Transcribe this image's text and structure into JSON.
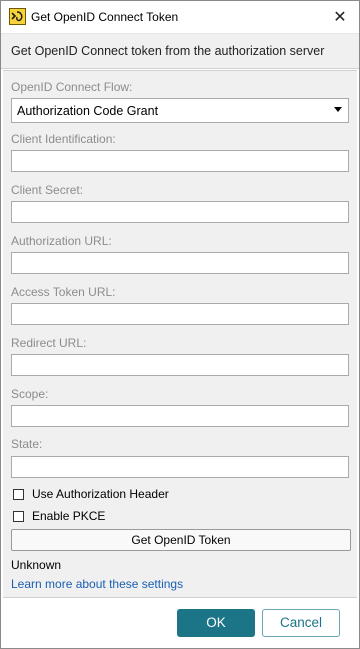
{
  "window": {
    "title": "Get OpenID Connect Token",
    "close_glyph": "✕",
    "app_icon": "app-logo-icon"
  },
  "header": {
    "description": "Get OpenID Connect token from the authorization server"
  },
  "form": {
    "flow_label": "OpenID Connect Flow:",
    "flow_value": "Authorization Code Grant",
    "client_id_label": "Client Identification:",
    "client_id_value": "",
    "client_secret_label": "Client Secret:",
    "client_secret_value": "",
    "auth_url_label": "Authorization URL:",
    "auth_url_value": "",
    "access_token_url_label": "Access Token URL:",
    "access_token_url_value": "",
    "redirect_url_label": "Redirect URL:",
    "redirect_url_value": "",
    "scope_label": "Scope:",
    "scope_value": "",
    "state_label": "State:",
    "state_value": "",
    "use_auth_header_label": "Use Authorization Header",
    "use_auth_header_checked": false,
    "enable_pkce_label": "Enable PKCE",
    "enable_pkce_checked": false,
    "get_token_label": "Get OpenID Token",
    "status_text": "Unknown",
    "learn_more_text": "Learn more about these settings"
  },
  "footer": {
    "ok_label": "OK",
    "cancel_label": "Cancel"
  },
  "colors": {
    "accent": "#1c7487",
    "link": "#1a5fb4",
    "panel_bg": "#f0f0f0",
    "label_gray": "#8c8c8c"
  }
}
